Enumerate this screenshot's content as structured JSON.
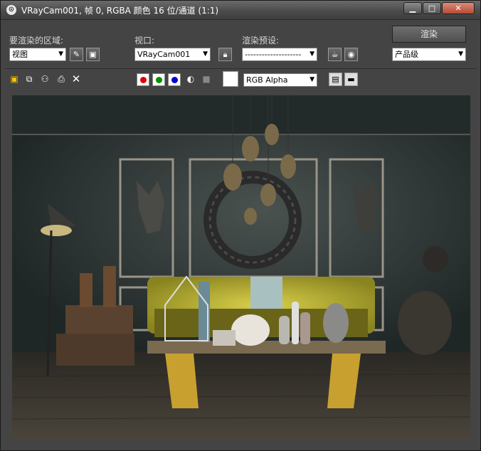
{
  "title": "VRayCam001, 帧 0, RGBA 颜色 16 位/通道 (1:1)",
  "window_controls": {
    "minimize": "▁",
    "maximize": "□",
    "close": "✕"
  },
  "controls": {
    "area_label": "要渲染的区域:",
    "area_value": "视图",
    "viewport_label": "视口:",
    "viewport_value": "VRayCam001",
    "preset_label": "渲染预设:",
    "preset_value": "--------------------",
    "render_label": "渲染",
    "quality_value": "产品级"
  },
  "toolbar": {
    "channel_value": "RGB Alpha"
  },
  "icons": [
    "save-icon",
    "copy-icon",
    "clone-icon",
    "print-icon",
    "clear-icon",
    "lock-icon",
    "teapot-icon",
    "settings-icon"
  ]
}
